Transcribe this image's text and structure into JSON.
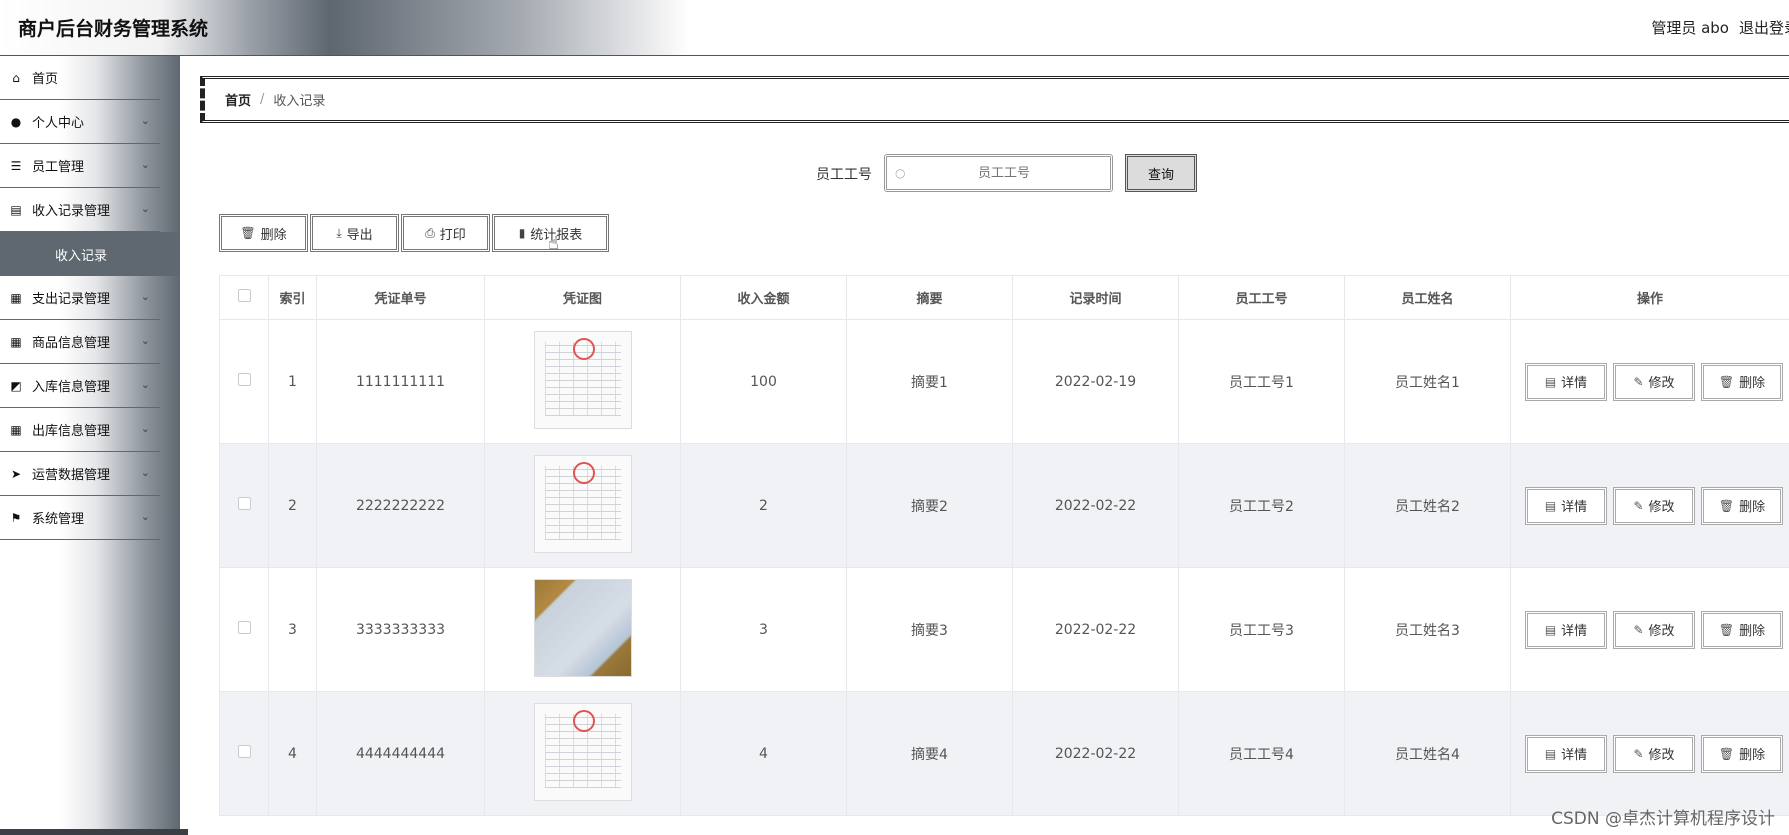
{
  "header": {
    "title": "商户后台财务管理系统",
    "user": "管理员 abo",
    "logout": "退出登录"
  },
  "sidebar": {
    "items": [
      {
        "label": "首页",
        "icon": "home-icon",
        "glyph": "⌂",
        "expandable": false
      },
      {
        "label": "个人中心",
        "icon": "user-icon",
        "glyph": "●",
        "expandable": true
      },
      {
        "label": "员工管理",
        "icon": "list-icon",
        "glyph": "☰",
        "expandable": true
      },
      {
        "label": "收入记录管理",
        "icon": "clipboard-icon",
        "glyph": "▤",
        "expandable": true
      },
      {
        "label": "支出记录管理",
        "icon": "grid-icon",
        "glyph": "▦",
        "expandable": true
      },
      {
        "label": "商品信息管理",
        "icon": "grid-icon",
        "glyph": "▦",
        "expandable": true
      },
      {
        "label": "入库信息管理",
        "icon": "chart-icon",
        "glyph": "◩",
        "expandable": true
      },
      {
        "label": "出库信息管理",
        "icon": "grid-icon",
        "glyph": "▦",
        "expandable": true
      },
      {
        "label": "运营数据管理",
        "icon": "send-icon",
        "glyph": "➤",
        "expandable": true
      },
      {
        "label": "系统管理",
        "icon": "flag-icon",
        "glyph": "⚑",
        "expandable": true
      }
    ],
    "sub_item": "收入记录"
  },
  "breadcrumb": {
    "home": "首页",
    "separator": "/",
    "current": "收入记录"
  },
  "search": {
    "label": "员工工号",
    "placeholder": "员工工号",
    "button": "查询"
  },
  "toolbar": {
    "delete": "删除",
    "export": "导出",
    "print": "打印",
    "report": "统计报表"
  },
  "table": {
    "headers": [
      "索引",
      "凭证单号",
      "凭证图",
      "收入金额",
      "摘要",
      "记录时间",
      "员工工号",
      "员工姓名",
      "操作"
    ],
    "rows": [
      {
        "index": "1",
        "voucher_no": "1111111111",
        "voucher_img": "paper",
        "amount": "100",
        "summary": "摘要1",
        "time": "2022-02-19",
        "emp_no": "员工工号1",
        "emp_name": "员工姓名1"
      },
      {
        "index": "2",
        "voucher_no": "2222222222",
        "voucher_img": "paper",
        "amount": "2",
        "summary": "摘要2",
        "time": "2022-02-22",
        "emp_no": "员工工号2",
        "emp_name": "员工姓名2"
      },
      {
        "index": "3",
        "voucher_no": "3333333333",
        "voucher_img": "photo",
        "amount": "3",
        "summary": "摘要3",
        "time": "2022-02-22",
        "emp_no": "员工工号3",
        "emp_name": "员工姓名3"
      },
      {
        "index": "4",
        "voucher_no": "4444444444",
        "voucher_img": "paper",
        "amount": "4",
        "summary": "摘要4",
        "time": "2022-02-22",
        "emp_no": "员工工号4",
        "emp_name": "员工姓名4"
      }
    ],
    "actions": {
      "detail": "详情",
      "edit": "修改",
      "delete": "删除"
    }
  },
  "watermark": "CSDN @卓杰计算机程序设计"
}
